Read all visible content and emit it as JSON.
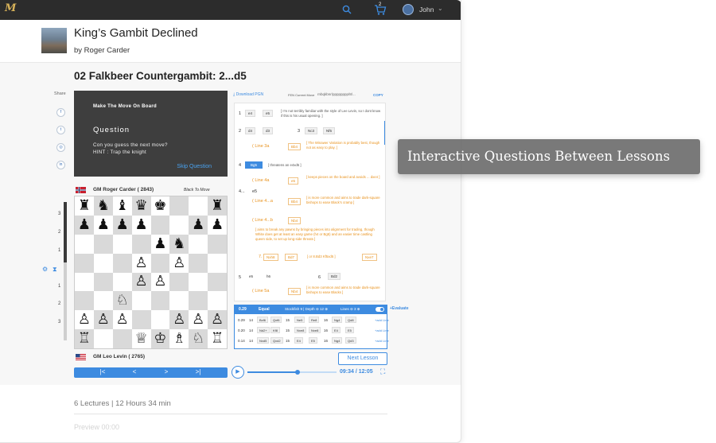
{
  "topbar": {
    "logo_text": "M",
    "user_name": "John",
    "cart_count": "2"
  },
  "course": {
    "title": "King’s Gambit Declined",
    "author": "by Roger Carder"
  },
  "lesson": {
    "title": "02  Falkbeer Countergambit: 2...d5"
  },
  "share": {
    "label": "Share",
    "icons": [
      "f",
      "t",
      "◎",
      "in"
    ]
  },
  "question_panel": {
    "make_move": "Make The Move On Board",
    "heading": "Question",
    "line1": "Con you guess the next move?",
    "line2": "HINT : Trap the knight",
    "skip": "Skip Question"
  },
  "players": {
    "top": {
      "name": "GM Roger Carder ( 2843)",
      "to_move": "Black To Move"
    },
    "bottom": {
      "name": "GM Leo Levin ( 2765)"
    }
  },
  "board_side_numbers": [
    "3",
    "2",
    "1",
    "1",
    "2",
    "3"
  ],
  "board": [
    [
      "♜",
      "♞",
      "♝",
      "♛",
      "♚",
      "",
      "",
      "♜"
    ],
    [
      "♟",
      "♟",
      "♟",
      "♟",
      "",
      "",
      "♟",
      "♟"
    ],
    [
      "",
      "",
      "",
      "",
      "♟",
      "♞",
      "",
      ""
    ],
    [
      "",
      "",
      "",
      "♙",
      "",
      "♙",
      "",
      ""
    ],
    [
      "",
      "",
      "",
      "♙",
      "♙",
      "",
      "",
      ""
    ],
    [
      "",
      "",
      "♘",
      "",
      "",
      "",
      "",
      ""
    ],
    [
      "♙",
      "♙",
      "♙",
      "",
      "",
      "♙",
      "♙",
      "♙"
    ],
    [
      "♖",
      "",
      "",
      "♕",
      "♔",
      "♗",
      "♘",
      "♖"
    ]
  ],
  "nav": {
    "first": "|<",
    "prev": "<",
    "next": ">",
    "last": ">|"
  },
  "move_panel": {
    "download": "Download PGN",
    "current_move_label": "FEN Current Move",
    "fen": "rnbqkbnr/pppppppp/8/...",
    "copy": "COPY",
    "moves": [
      {
        "n": "1",
        "w": "e4",
        "b": "e5",
        "note": "[ I’m not terribly familiar with the style of Lee Levin, so I dont know if this is his usual opening. ]"
      },
      {
        "n": "2",
        "w": "d4",
        "b": "d3",
        "n2": "3",
        "w2": "Nc3",
        "b2": "Nf6"
      },
      {
        "line": "( Line 3a",
        "box": "Bb4",
        "note": "[ The Winawer Variation is probably best, though not as easy to play. ]"
      },
      {
        "n": "4",
        "sel": "Bg5",
        "note": "[ threatens an e4xd5 ]"
      },
      {
        "line": "( Line 4a",
        "box": "e5",
        "note": "[ keeps pieces on the board and avoids ... dxe4 ]"
      },
      {
        "n": "4...",
        "w": "e5"
      },
      {
        "line": "( Line 4...a",
        "box": "Bb4",
        "note": "[ is more common and aims to trade dark-square bishops to ease Black’s cramp ]"
      },
      {
        "line": "( Line 4...b",
        "box": "Nb4",
        "note": "[ aims to break any pawns by bringing pieces into alignment for trading, though White does get at least an easy game (h4 or Bg5) and an easier time castling queen side, to set up long-side threats ]"
      },
      {
        "sub": "7.",
        "b1": "Nxh8",
        "b2": "Bd7",
        "note": "[ or 8.Bd3 Kf5xd5 ]",
        "b3": "Nxe7"
      },
      {
        "n": "5",
        "w": "e5",
        "b": "h6",
        "n2": "6",
        "w2": "Bd2"
      },
      {
        "line": "( Line 5a",
        "box": "Nb4",
        "note": "[ is more common and aims to trade dark-square bishops to ease Blacks ]"
      }
    ]
  },
  "engine": {
    "score": "0.29",
    "eval": "Equal",
    "engine_label": "Stockfish 9 | Depth ⊖ 12 ⊕",
    "lines_label": "Lines ⊖ 3 ⊕",
    "evaluate": "+Evaluate",
    "rows": [
      {
        "s": "0.29",
        "cells": [
          "14",
          "Bxf6",
          "Qxf6",
          "15",
          "Ne5",
          "Re8",
          "16",
          "Ng4",
          "Qd8"
        ],
        "more": "+add Line"
      },
      {
        "s": "0.20",
        "cells": [
          "14",
          "Nd2+",
          "Kf8",
          "15",
          "Nxe8",
          "Nxe8",
          "16",
          "E4",
          "E5"
        ],
        "more": "+add Line"
      },
      {
        "s": "0.14",
        "cells": [
          "14",
          "Nxd5",
          "Qxd2",
          "15",
          "E4",
          "E5",
          "16",
          "Ng4",
          "Qd3"
        ],
        "more": "+add Line"
      }
    ]
  },
  "player_bar": {
    "next_lesson": "Next Lesson",
    "time": "09:34 / 12:05",
    "progress": 0.56
  },
  "stats": {
    "text": "6 Lectures |  12 Hours  34 min"
  },
  "faded": {
    "text": "Preview    00:00"
  },
  "tooltip": {
    "text": "Interactive Questions Between Lessons"
  },
  "colors": {
    "accent": "#3d8be0",
    "dark_panel": "#3e3e3e",
    "orange": "#e8911b"
  }
}
